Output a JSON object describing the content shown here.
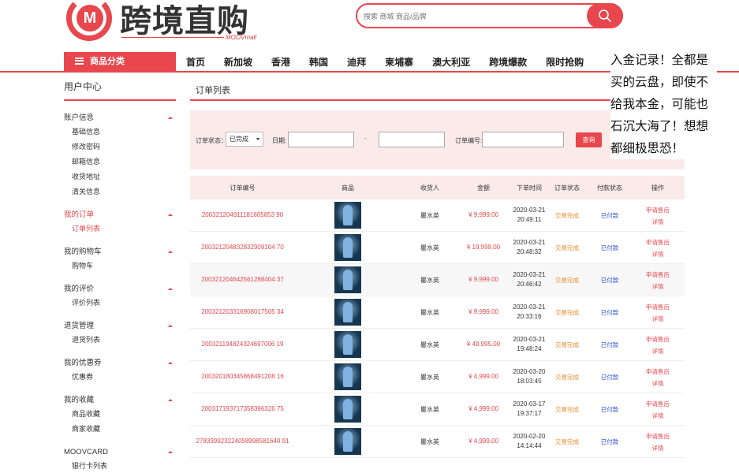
{
  "header": {
    "logo_mark": "M",
    "logo_text": "跨境直购",
    "logo_sub": "MOOVmall",
    "search_placeholder": "搜索 商城 商品/品牌"
  },
  "nav": {
    "category_label": "商品分类",
    "items": [
      "首页",
      "新加坡",
      "香港",
      "韩国",
      "迪拜",
      "柬埔寨",
      "澳大利亚",
      "跨境爆款",
      "限时抢购"
    ]
  },
  "overlay_text": "入金记录！全都是买的云盘，即使不给我本金，可能也石沉大海了！想想都细极思恐！",
  "sidebar": {
    "title": "用户中心",
    "groups": [
      {
        "label": "账户信息",
        "items": [
          "基础信息",
          "修改密码",
          "邮箱信息",
          "收货地址",
          "清关信息"
        ]
      },
      {
        "label": "我的订单",
        "items": [
          "订单列表"
        ]
      },
      {
        "label": "我的购物车",
        "items": [
          "购物车"
        ]
      },
      {
        "label": "我的评价",
        "items": [
          "评价列表"
        ]
      },
      {
        "label": "退货管理",
        "items": [
          "退货列表"
        ]
      },
      {
        "label": "我的优惠券",
        "items": [
          "优惠券"
        ]
      },
      {
        "label": "我的收藏",
        "items": [
          "商品收藏",
          "商家收藏"
        ]
      },
      {
        "label": "MOOVCARD",
        "items": [
          "银行卡列表"
        ]
      }
    ]
  },
  "main": {
    "title": "订单列表",
    "filter": {
      "status_label": "订单状态：",
      "status_value": "已完成",
      "date_label": "日期:",
      "date_sep": "-",
      "order_no_label": "订单编号:",
      "query_button": "查询"
    },
    "columns": [
      "订单编号",
      "商品",
      "收货人",
      "金额",
      "下单时间",
      "订单状态",
      "付款状态",
      "操作"
    ],
    "rows": [
      {
        "no": "200321204911181605853 90",
        "name": "瞿水英",
        "amount": "¥ 9,999.00",
        "date": "2020-03-21",
        "time": "20:49:11",
        "status": "交易完成",
        "pay": "已付款",
        "op1": "申请售后",
        "op2": "详情"
      },
      {
        "no": "200321204832832909104 70",
        "name": "瞿水英",
        "amount": "¥ 19,999.00",
        "date": "2020-03-21",
        "time": "20:48:32",
        "status": "交易完成",
        "pay": "已付款",
        "op1": "申请售后",
        "op2": "详情"
      },
      {
        "no": "200321204642561288404 37",
        "name": "瞿水英",
        "amount": "¥ 9,999.00",
        "date": "2020-03-21",
        "time": "20:46:42",
        "status": "交易完成",
        "pay": "已付款",
        "op1": "申请售后",
        "op2": "详情"
      },
      {
        "no": "200321203316908017505 34",
        "name": "瞿水英",
        "amount": "¥ 9,999.00",
        "date": "2020-03-21",
        "time": "20:33:16",
        "status": "交易完成",
        "pay": "已付款",
        "op1": "申请售后",
        "op2": "详情"
      },
      {
        "no": "200321194824324697006 19",
        "name": "瞿水英",
        "amount": "¥ 49,995.00",
        "date": "2020-03-21",
        "time": "19:48:24",
        "status": "交易完成",
        "pay": "已付款",
        "op1": "申请售后",
        "op2": "详情"
      },
      {
        "no": "200320180345868491208 16",
        "name": "瞿水英",
        "amount": "¥ 4,999.00",
        "date": "2020-03-20",
        "time": "18:03:45",
        "status": "交易完成",
        "pay": "已付款",
        "op1": "申请售后",
        "op2": "详情"
      },
      {
        "no": "200317193717358396326 75",
        "name": "瞿水英",
        "amount": "¥ 4,999.00",
        "date": "2020-03-17",
        "time": "19:37:17",
        "status": "交易完成",
        "pay": "已付款",
        "op1": "申请售后",
        "op2": "详情"
      },
      {
        "no": "278339923224058998581640 91",
        "name": "瞿水英",
        "amount": "¥ 4,999.00",
        "date": "2020-02-20",
        "time": "14:14:44",
        "status": "交易完成",
        "pay": "已付款",
        "op1": "申请售后",
        "op2": "详情"
      }
    ]
  }
}
